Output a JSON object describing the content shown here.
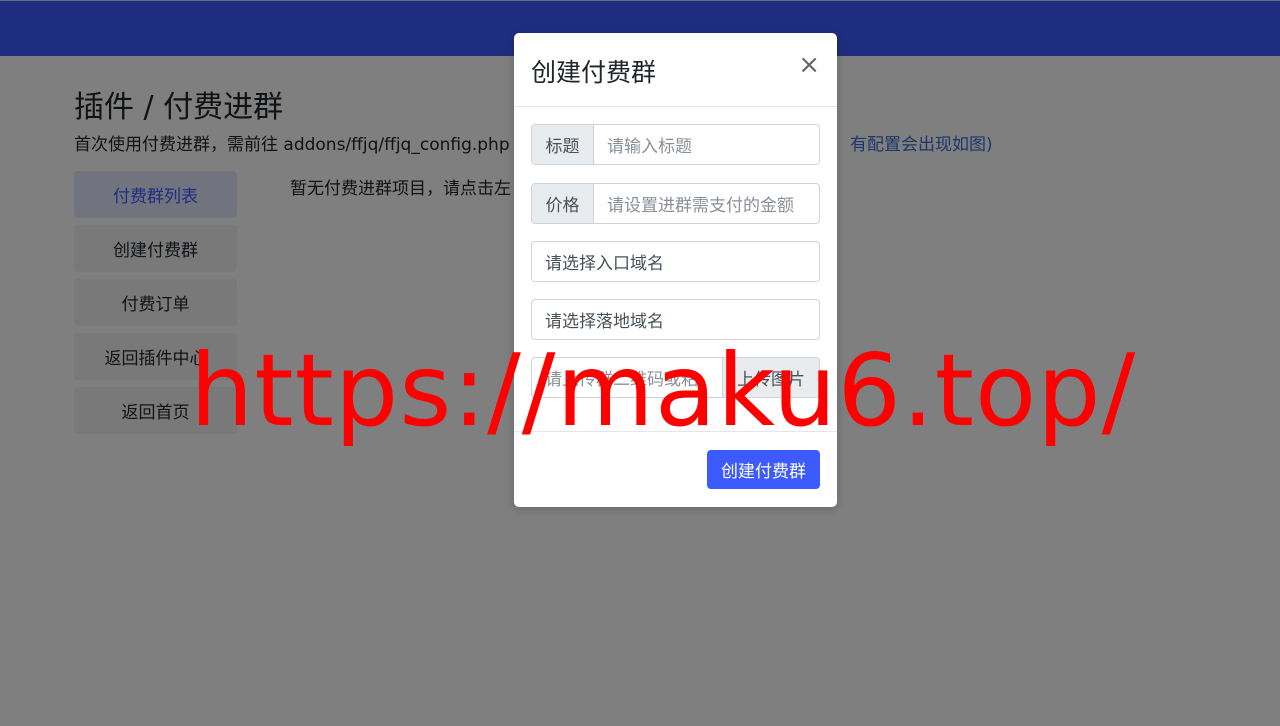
{
  "page": {
    "title": "插件 / 付费进群",
    "description": "首次使用付费进群，需前往 addons/ffjq/ffjq_config.php 进",
    "description_link": "有配置会出现如图)",
    "empty_message": "暂无付费进群项目，请点击左"
  },
  "sidebar": {
    "items": [
      {
        "label": "付费群列表",
        "active": true
      },
      {
        "label": "创建付费群",
        "active": false
      },
      {
        "label": "付费订单",
        "active": false
      },
      {
        "label": "返回插件中心",
        "active": false
      },
      {
        "label": "返回首页",
        "active": false
      }
    ]
  },
  "modal": {
    "title": "创建付费群",
    "close_label": "×",
    "fields": {
      "title_addon": "标题",
      "title_placeholder": "请输入标题",
      "price_addon": "价格",
      "price_placeholder": "请设置进群需支付的金额",
      "entry_domain_placeholder": "请选择入口域名",
      "landing_domain_placeholder": "请选择落地域名",
      "qr_placeholder": "请上传群二维码或粘",
      "upload_label": "上传图片"
    },
    "submit_label": "创建付费群"
  },
  "watermark": "https://maku6.top/",
  "colors": {
    "brand": "#3d5afe",
    "watermark": "#ff0000",
    "link": "#3b6fd6"
  }
}
